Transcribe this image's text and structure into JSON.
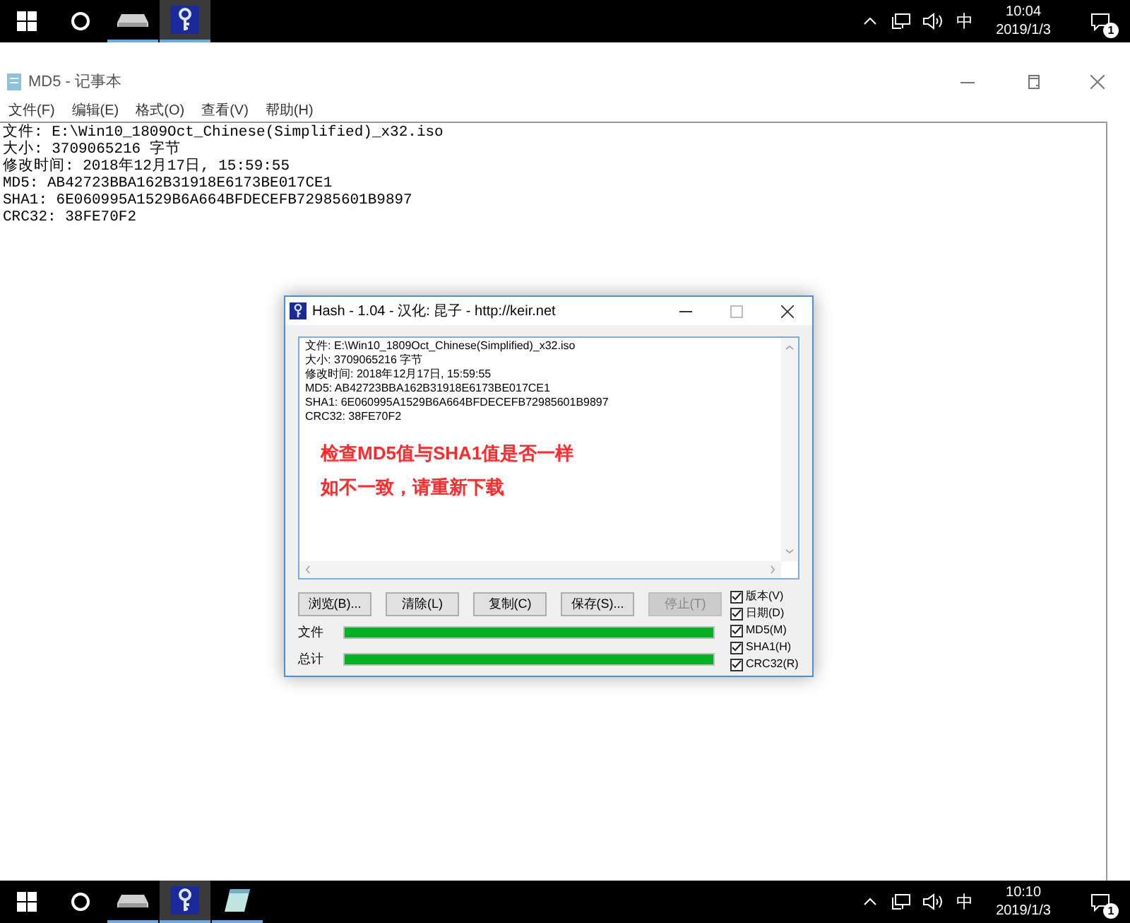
{
  "top_taskbar": {
    "apps": [
      {
        "kind": "drive",
        "active": false
      },
      {
        "kind": "hash",
        "active": true
      }
    ],
    "tray": {
      "ime": "中",
      "time": "10:04",
      "date": "2019/1/3",
      "notifications": "1"
    }
  },
  "notepad": {
    "title": "MD5 - 记事本",
    "menu": [
      "文件(F)",
      "编辑(E)",
      "格式(O)",
      "查看(V)",
      "帮助(H)"
    ],
    "lines": [
      "文件: E:\\Win10_1809Oct_Chinese(Simplified)_x32.iso",
      "大小: 3709065216 字节",
      "修改时间: 2018年12月17日, 15:59:55",
      "MD5: AB42723BBA162B31918E6173BE017CE1",
      "SHA1: 6E060995A1529B6A664BFDECEFB72985601B9897",
      "CRC32: 38FE70F2"
    ]
  },
  "hash_dialog": {
    "title": "Hash - 1.04 - 汉化: 昆子 - http://keir.net",
    "lines": [
      "文件: E:\\Win10_1809Oct_Chinese(Simplified)_x32.iso",
      "大小: 3709065216 字节",
      "修改时间: 2018年12月17日, 15:59:55",
      "MD5: AB42723BBA162B31918E6173BE017CE1",
      "SHA1: 6E060995A1529B6A664BFDECEFB72985601B9897",
      "CRC32: 38FE70F2"
    ],
    "notes": [
      "检查MD5值与SHA1值是否一样",
      "如不一致，请重新下载"
    ],
    "buttons": [
      {
        "label": "浏览(B)...",
        "disabled": false
      },
      {
        "label": "清除(L)",
        "disabled": false
      },
      {
        "label": "复制(C)",
        "disabled": false
      },
      {
        "label": "保存(S)...",
        "disabled": false
      },
      {
        "label": "停止(T)",
        "disabled": true
      }
    ],
    "progress": [
      {
        "label": "文件",
        "level": 1
      },
      {
        "label": "总计",
        "level": 1
      }
    ],
    "options": [
      {
        "label": "版本(V)",
        "checked": true
      },
      {
        "label": "日期(D)",
        "checked": true
      },
      {
        "label": "MD5(M)",
        "checked": true
      },
      {
        "label": "SHA1(H)",
        "checked": true
      },
      {
        "label": "CRC32(R)",
        "checked": true
      }
    ]
  },
  "bottom_taskbar": {
    "apps": [
      {
        "kind": "drive",
        "active": false
      },
      {
        "kind": "hash",
        "active": true
      },
      {
        "kind": "notepad",
        "active": false
      }
    ],
    "tray": {
      "ime": "中",
      "time": "10:10",
      "date": "2019/1/3",
      "notifications": "1"
    }
  }
}
